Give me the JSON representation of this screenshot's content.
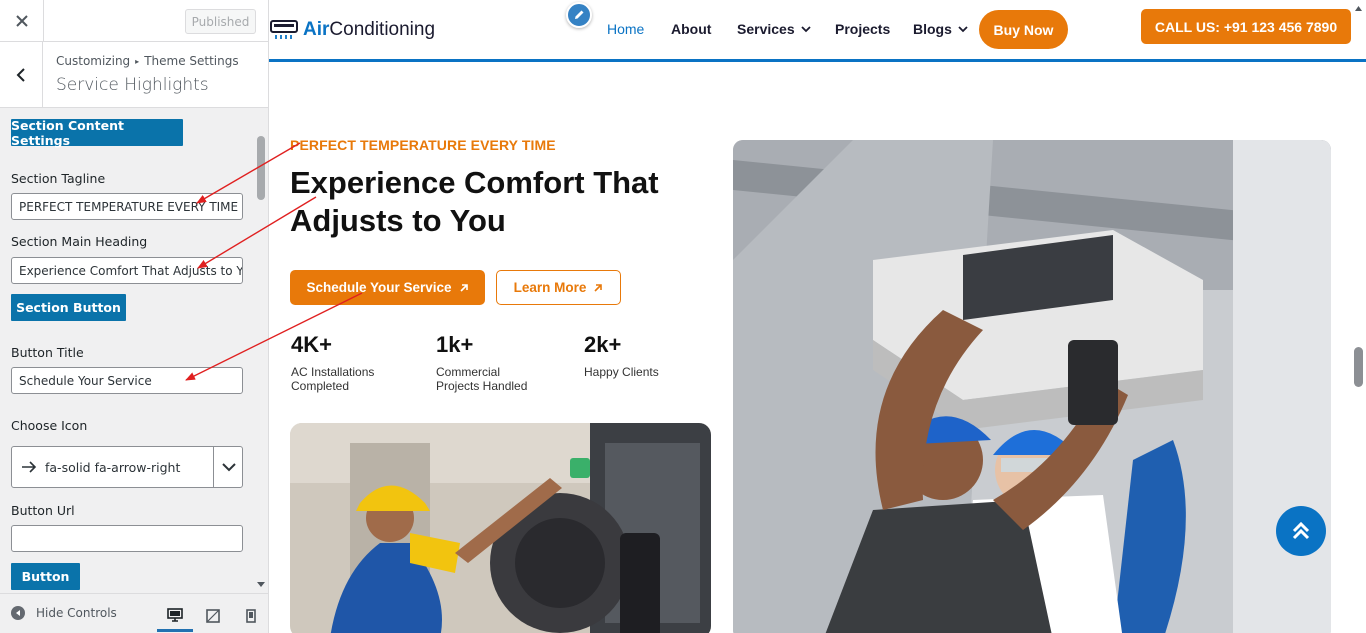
{
  "customizer": {
    "published_label": "Published",
    "breadcrumb": {
      "root": "Customizing",
      "section": "Theme Settings"
    },
    "panel_title": "Service Highlights",
    "content_settings_btn": "Section Content Settings",
    "tagline_label": "Section Tagline",
    "tagline_value": "PERFECT TEMPERATURE EVERY TIME",
    "heading_label": "Section Main Heading",
    "heading_value": "Experience Comfort That Adjusts to You",
    "section_button_btn": "Section Button",
    "button_title_label": "Button Title",
    "button_title_value": "Schedule Your Service",
    "icon_label": "Choose Icon",
    "icon_value": "fa-solid fa-arrow-right",
    "button_url_label": "Button Url",
    "button_url_value": "",
    "button_btn": "Button",
    "hide_controls": "Hide Controls"
  },
  "site": {
    "logo": {
      "bold": "Air",
      "rest": "Conditioning"
    },
    "nav": [
      "Home",
      "About",
      "Services",
      "Projects",
      "Blogs"
    ],
    "buy_now": "Buy Now",
    "call_us": "CALL US: +91 123 456 7890",
    "tagline": "PERFECT TEMPERATURE EVERY TIME",
    "heading": "Experience Comfort That Adjusts to You",
    "primary_btn": "Schedule Your Service",
    "secondary_btn": "Learn More",
    "stats": [
      {
        "value": "4K+",
        "label": "AC Installations Completed"
      },
      {
        "value": "1k+",
        "label": "Commercial Projects Handled"
      },
      {
        "value": "2k+",
        "label": "Happy Clients"
      }
    ]
  },
  "colors": {
    "accent": "#e8790a",
    "brand_blue": "#0a73c4",
    "wp_button": "#0a73aa",
    "annotation": "#e02020"
  }
}
